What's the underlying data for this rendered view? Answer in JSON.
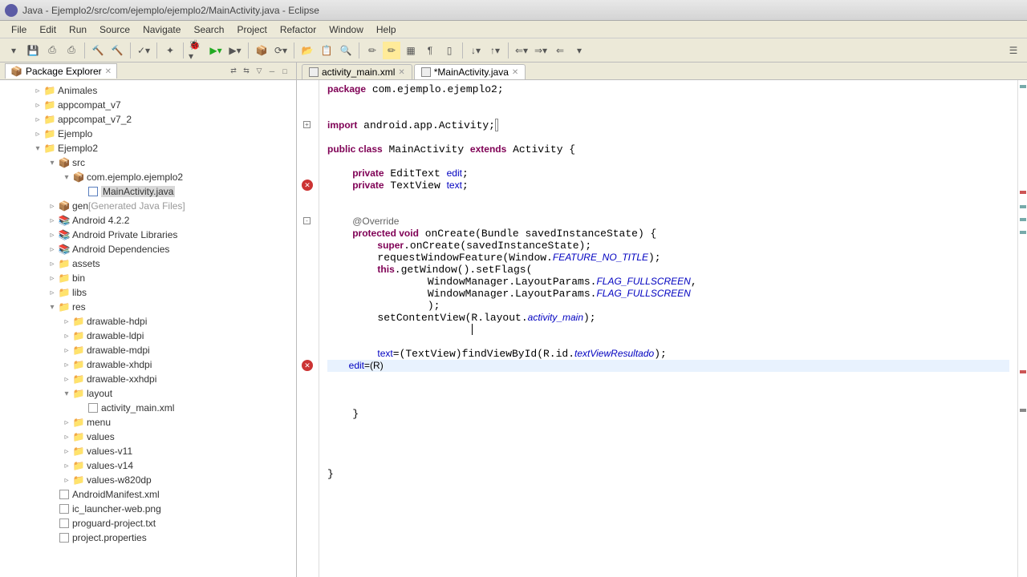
{
  "title": "Java - Ejemplo2/src/com/ejemplo/ejemplo2/MainActivity.java - Eclipse",
  "menu": [
    "File",
    "Edit",
    "Run",
    "Source",
    "Navigate",
    "Search",
    "Project",
    "Refactor",
    "Window",
    "Help"
  ],
  "sidebar_title": "Package Explorer",
  "tree": [
    {
      "d": 0,
      "t": "twist",
      "tw": "▹",
      "ic": "proj",
      "lbl": "Animales"
    },
    {
      "d": 0,
      "t": "twist",
      "tw": "▹",
      "ic": "proj",
      "lbl": "appcompat_v7"
    },
    {
      "d": 0,
      "t": "twist",
      "tw": "▹",
      "ic": "proj",
      "lbl": "appcompat_v7_2"
    },
    {
      "d": 0,
      "t": "twist",
      "tw": "▹",
      "ic": "proj",
      "lbl": "Ejemplo"
    },
    {
      "d": 0,
      "t": "twist",
      "tw": "▾",
      "ic": "proj",
      "lbl": "Ejemplo2"
    },
    {
      "d": 1,
      "t": "twist",
      "tw": "▾",
      "ic": "pkg",
      "lbl": "src"
    },
    {
      "d": 2,
      "t": "twist",
      "tw": "▾",
      "ic": "pkg",
      "lbl": "com.ejemplo.ejemplo2"
    },
    {
      "d": 3,
      "t": "leaf",
      "tw": "",
      "ic": "java",
      "lbl": "MainActivity.java",
      "sel": true
    },
    {
      "d": 1,
      "t": "twist",
      "tw": "▹",
      "ic": "pkg",
      "lbl": "gen",
      "suf": "[Generated Java Files]"
    },
    {
      "d": 1,
      "t": "twist",
      "tw": "▹",
      "ic": "lib",
      "lbl": "Android 4.2.2"
    },
    {
      "d": 1,
      "t": "twist",
      "tw": "▹",
      "ic": "lib",
      "lbl": "Android Private Libraries"
    },
    {
      "d": 1,
      "t": "twist",
      "tw": "▹",
      "ic": "lib",
      "lbl": "Android Dependencies"
    },
    {
      "d": 1,
      "t": "twist",
      "tw": "▹",
      "ic": "folder",
      "lbl": "assets"
    },
    {
      "d": 1,
      "t": "twist",
      "tw": "▹",
      "ic": "folder",
      "lbl": "bin"
    },
    {
      "d": 1,
      "t": "twist",
      "tw": "▹",
      "ic": "folder",
      "lbl": "libs"
    },
    {
      "d": 1,
      "t": "twist",
      "tw": "▾",
      "ic": "folder",
      "lbl": "res"
    },
    {
      "d": 2,
      "t": "twist",
      "tw": "▹",
      "ic": "folder",
      "lbl": "drawable-hdpi"
    },
    {
      "d": 2,
      "t": "twist",
      "tw": "▹",
      "ic": "folder",
      "lbl": "drawable-ldpi"
    },
    {
      "d": 2,
      "t": "twist",
      "tw": "▹",
      "ic": "folder",
      "lbl": "drawable-mdpi"
    },
    {
      "d": 2,
      "t": "twist",
      "tw": "▹",
      "ic": "folder",
      "lbl": "drawable-xhdpi"
    },
    {
      "d": 2,
      "t": "twist",
      "tw": "▹",
      "ic": "folder",
      "lbl": "drawable-xxhdpi"
    },
    {
      "d": 2,
      "t": "twist",
      "tw": "▾",
      "ic": "folder",
      "lbl": "layout"
    },
    {
      "d": 3,
      "t": "leaf",
      "tw": "",
      "ic": "file",
      "lbl": "activity_main.xml"
    },
    {
      "d": 2,
      "t": "twist",
      "tw": "▹",
      "ic": "folder",
      "lbl": "menu"
    },
    {
      "d": 2,
      "t": "twist",
      "tw": "▹",
      "ic": "folder",
      "lbl": "values"
    },
    {
      "d": 2,
      "t": "twist",
      "tw": "▹",
      "ic": "folder",
      "lbl": "values-v11"
    },
    {
      "d": 2,
      "t": "twist",
      "tw": "▹",
      "ic": "folder",
      "lbl": "values-v14"
    },
    {
      "d": 2,
      "t": "twist",
      "tw": "▹",
      "ic": "folder",
      "lbl": "values-w820dp"
    },
    {
      "d": 1,
      "t": "leaf",
      "tw": "",
      "ic": "file",
      "lbl": "AndroidManifest.xml"
    },
    {
      "d": 1,
      "t": "leaf",
      "tw": "",
      "ic": "file",
      "lbl": "ic_launcher-web.png"
    },
    {
      "d": 1,
      "t": "leaf",
      "tw": "",
      "ic": "file",
      "lbl": "proguard-project.txt"
    },
    {
      "d": 1,
      "t": "leaf",
      "tw": "",
      "ic": "file",
      "lbl": "project.properties"
    }
  ],
  "tabs": [
    {
      "label": "activity_main.xml",
      "active": false
    },
    {
      "label": "*MainActivity.java",
      "active": true
    }
  ],
  "code_lines": [
    {
      "t": "<span class='kw'>package</span> com.ejemplo.ejemplo2;"
    },
    {
      "t": ""
    },
    {
      "t": ""
    },
    {
      "t": "<span class='kw'>import</span> android.app.Activity;",
      "fold": "+",
      "box": true
    },
    {
      "t": ""
    },
    {
      "t": "<span class='kw'>public class</span> MainActivity <span class='kw'>extends</span> Activity {"
    },
    {
      "t": ""
    },
    {
      "t": "    <span class='kw'>private</span> EditText <span class='fld'>edit</span>;"
    },
    {
      "t": "    <span class='kw'>private</span> TextView <span class='fld'>text</span>;",
      "err": true
    },
    {
      "t": ""
    },
    {
      "t": ""
    },
    {
      "t": "    <span class='ann'>@Override</span>",
      "fold": "-"
    },
    {
      "t": "    <span class='kw'>protected void</span> onCreate(Bundle savedInstanceState) {"
    },
    {
      "t": "        <span class='kw'>super</span>.onCreate(savedInstanceState);"
    },
    {
      "t": "        requestWindowFeature(Window.<span class='sit'>FEATURE_NO_TITLE</span>);"
    },
    {
      "t": "        <span class='kw'>this</span>.getWindow().setFlags("
    },
    {
      "t": "                WindowManager.LayoutParams.<span class='sit'>FLAG_FULLSCREEN</span>,"
    },
    {
      "t": "                WindowManager.LayoutParams.<span class='sit'>FLAG_FULLSCREEN</span>"
    },
    {
      "t": "                );"
    },
    {
      "t": "        setContentView(R.layout.<span class='sit'>activity_main</span>);"
    },
    {
      "t": ""
    },
    {
      "t": ""
    },
    {
      "t": "        <span class='fld'>text</span>=(TextView)findViewById(R.id.<span class='sit'>textViewResultado</span>);"
    },
    {
      "t": "        <span class='fld'>edit</span>=(R)",
      "err": true,
      "cur": true
    },
    {
      "t": ""
    },
    {
      "t": ""
    },
    {
      "t": ""
    },
    {
      "t": "    }"
    },
    {
      "t": ""
    },
    {
      "t": ""
    },
    {
      "t": ""
    },
    {
      "t": ""
    },
    {
      "t": "}"
    }
  ]
}
